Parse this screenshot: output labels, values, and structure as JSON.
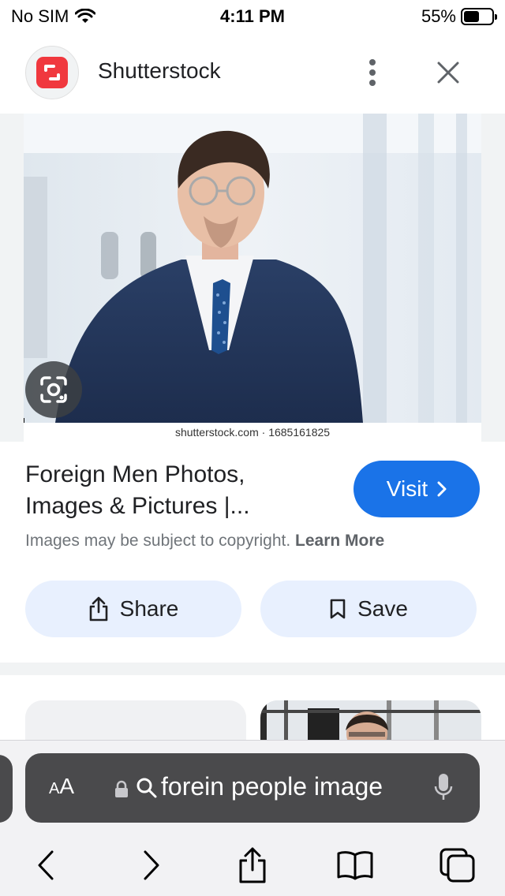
{
  "status_bar": {
    "carrier": "No SIM",
    "time": "4:11 PM",
    "battery_percent": "55%",
    "battery_level": 0.55
  },
  "header": {
    "site_name": "Shutterstock",
    "logo_color": "#f0383e"
  },
  "image": {
    "watermark": "shutterstock.com · 1685161825"
  },
  "result": {
    "title_line1": "Foreign Men Photos,",
    "title_line2": "Images & Pictures |...",
    "visit_label": "Visit",
    "copyright_text": "Images may be subject to copyright.",
    "learn_more": "Learn More",
    "share_label": "Share",
    "save_label": "Save"
  },
  "toolbar": {
    "aa_label_small": "A",
    "aa_label_large": "A",
    "url_text": "forein people image"
  },
  "colors": {
    "accent": "#1a73e8",
    "action_bg": "#e8f0fe",
    "url_bar_bg": "#4a4a4c"
  }
}
